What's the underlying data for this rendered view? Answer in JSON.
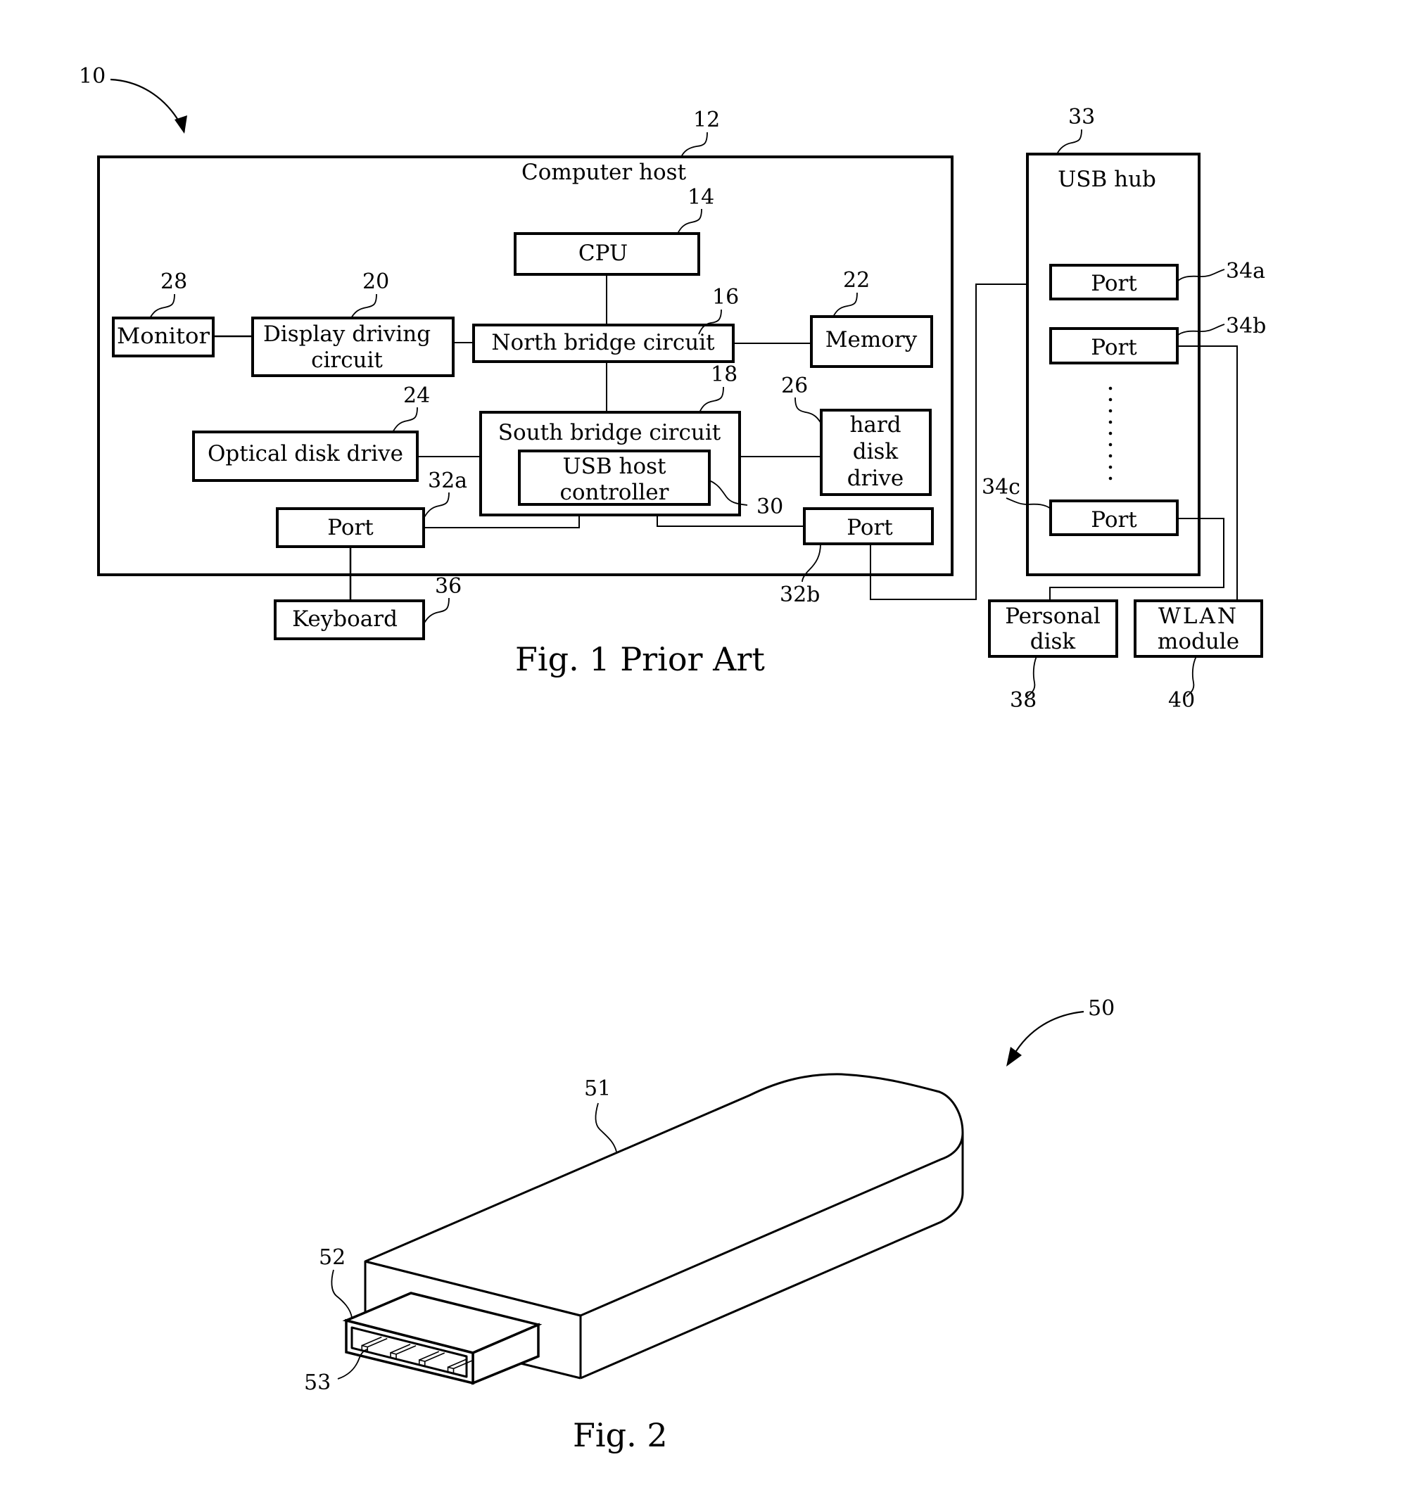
{
  "figure1": {
    "caption": "Fig. 1 Prior Art",
    "system_ref": "10",
    "computer_host": {
      "label": "Computer host",
      "ref": "12"
    },
    "cpu": {
      "label": "CPU",
      "ref": "14"
    },
    "north_bridge": {
      "label": "North bridge circuit",
      "ref": "16"
    },
    "south_bridge": {
      "label": "South bridge circuit",
      "ref": "18"
    },
    "display_driving": {
      "lines": [
        "Display driving",
        "circuit"
      ],
      "ref": "20"
    },
    "memory": {
      "label": "Memory",
      "ref": "22"
    },
    "optical_disk": {
      "label": "Optical disk drive",
      "ref": "24"
    },
    "hard_disk": {
      "lines": [
        "hard",
        "disk",
        "drive"
      ],
      "ref": "26"
    },
    "monitor": {
      "label": "Monitor",
      "ref": "28"
    },
    "usb_host_controller": {
      "lines": [
        "USB host",
        "controller"
      ],
      "ref": "30"
    },
    "port_a": {
      "label": "Port",
      "ref": "32a"
    },
    "port_b": {
      "label": "Port",
      "ref": "32b"
    },
    "keyboard": {
      "label": "Keyboard",
      "ref": "36"
    },
    "usb_hub": {
      "label": "USB hub",
      "ref": "33",
      "ports": [
        {
          "label": "Port",
          "ref": "34a"
        },
        {
          "label": "Port",
          "ref": "34b"
        },
        {
          "label": "Port",
          "ref": "34c"
        }
      ],
      "ellipsis_dots": 9
    },
    "personal_disk": {
      "lines": [
        "Personal",
        "disk"
      ],
      "ref": "38"
    },
    "wlan_module": {
      "lines": [
        "WLAN",
        "module"
      ],
      "ref": "40"
    }
  },
  "figure2": {
    "caption": "Fig. 2",
    "device_ref": "50",
    "housing_ref": "51",
    "connector_ref": "52",
    "contacts_ref": "53",
    "contact_count": 4
  },
  "colors": {
    "ink": "#000000",
    "paper": "#ffffff"
  }
}
